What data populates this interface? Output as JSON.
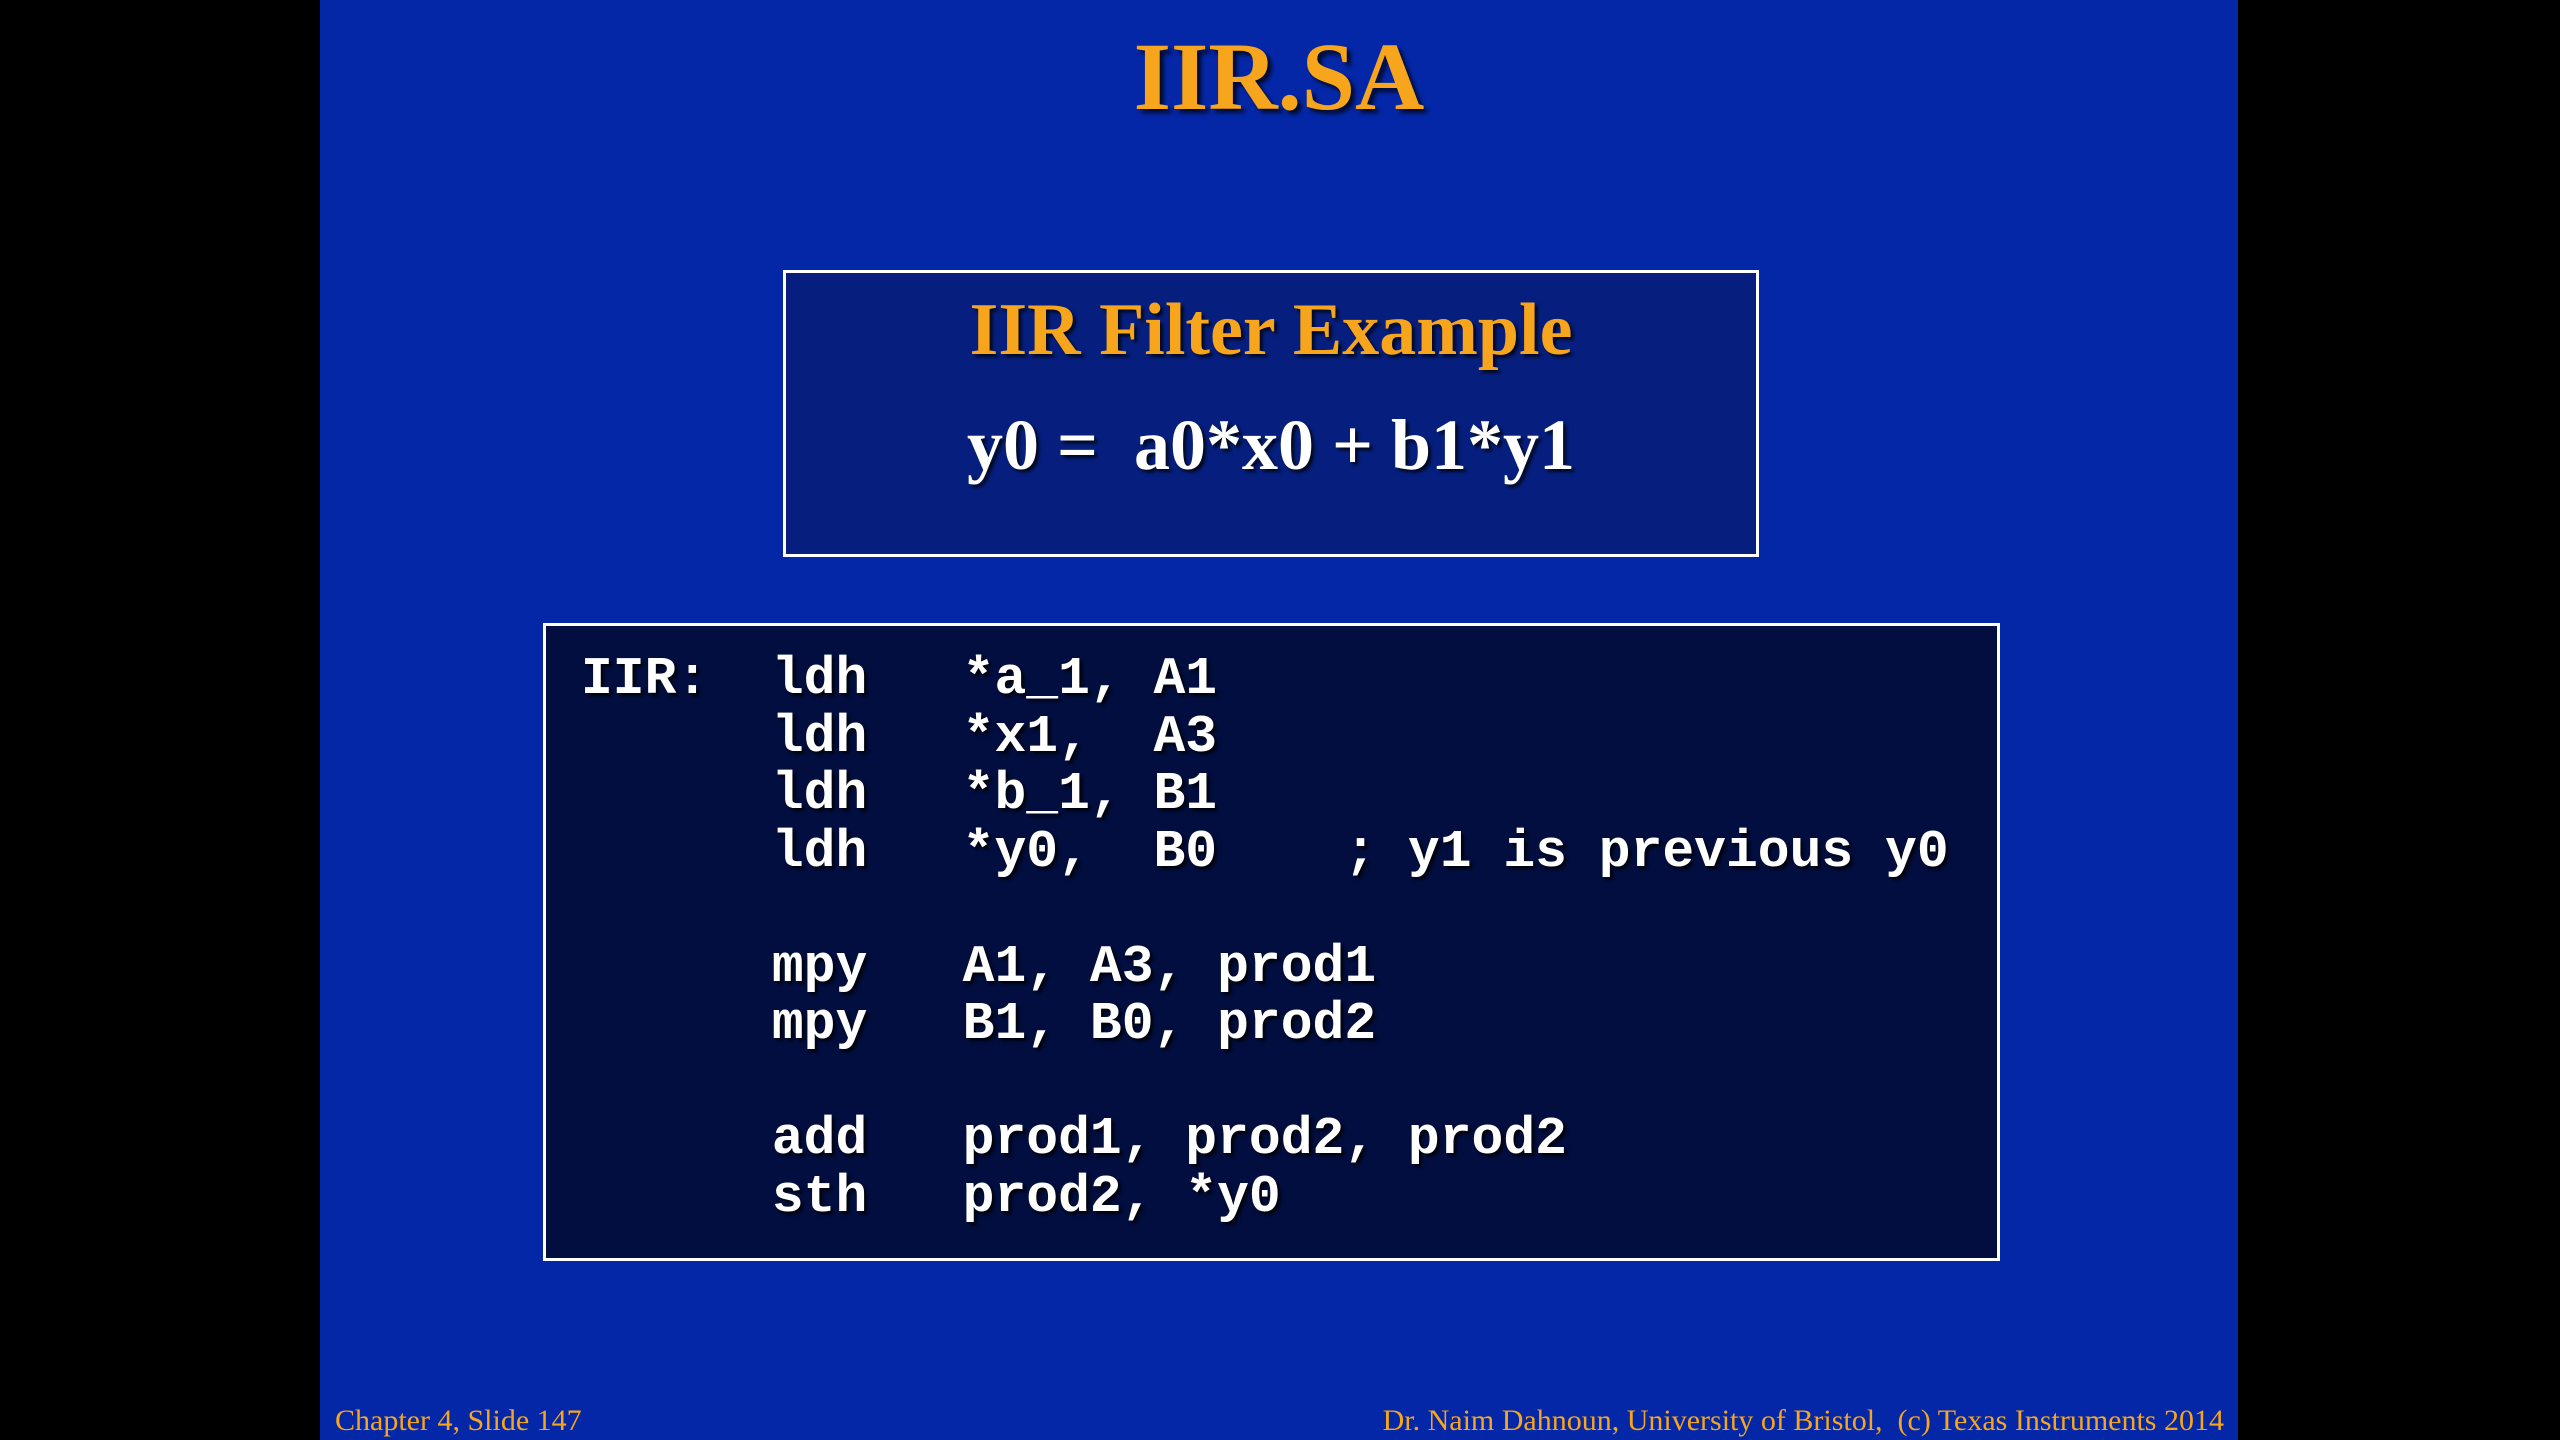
{
  "slide": {
    "title": "IIR.SA",
    "example_box": {
      "heading": "IIR Filter Example",
      "equation": "y0 =  a0*x0 + b1*y1"
    },
    "code_lines": [
      "IIR:  ldh   *a_1, A1",
      "      ldh   *x1,  A3",
      "      ldh   *b_1, B1",
      "      ldh   *y0,  B0    ; y1 is previous y0",
      "",
      "      mpy   A1, A3, prod1",
      "      mpy   B1, B0, prod2",
      "",
      "      add   prod1, prod2, prod2",
      "      sth   prod2, *y0"
    ],
    "footer_left": "Chapter 4, Slide 147",
    "footer_right": "Dr. Naim Dahnoun, University of Bristol,  (c) Texas Instruments 2014"
  },
  "colors": {
    "slide_background": "#0427a8",
    "title_orange": "#f7a51c",
    "example_box_background": "#061f7e",
    "code_box_background": "#020e3f",
    "text_white": "#ffffff",
    "letterbox": "#000000"
  }
}
